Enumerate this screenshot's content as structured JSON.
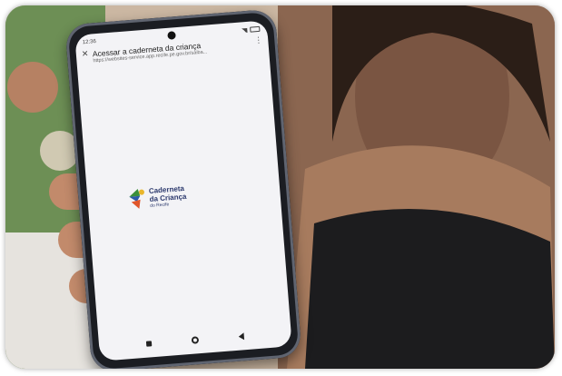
{
  "phone": {
    "status_time": "12:36",
    "page_title": "Acessar a caderneta da criança",
    "page_url": "https://websites-service.app.recife.pe.gov.br/saiba...",
    "logo": {
      "line1": "Caderneta",
      "line2": "da Criança",
      "line3": "do Recife"
    }
  }
}
